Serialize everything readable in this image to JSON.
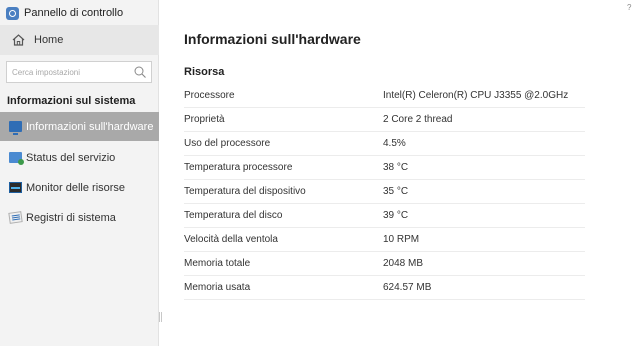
{
  "app": {
    "title": "Pannello di controllo"
  },
  "sidebar": {
    "home_label": "Home",
    "search_placeholder": "Cerca impostazioni",
    "section_title": "Informazioni sul sistema",
    "items": [
      {
        "label": "Informazioni sull'hardware",
        "icon": "hardware-icon",
        "active": true
      },
      {
        "label": "Status del servizio",
        "icon": "service-status-icon",
        "active": false
      },
      {
        "label": "Monitor delle risorse",
        "icon": "resource-monitor-icon",
        "active": false
      },
      {
        "label": "Registri di sistema",
        "icon": "system-logs-icon",
        "active": false
      }
    ]
  },
  "help_label": "?",
  "main": {
    "title": "Informazioni sull'hardware",
    "section": "Risorsa",
    "rows": [
      {
        "key": "Processore",
        "value": "Intel(R) Celeron(R) CPU J3355 @2.0GHz"
      },
      {
        "key": "Proprietà",
        "value": "2 Core 2 thread"
      },
      {
        "key": "Uso del processore",
        "value": "4.5%"
      },
      {
        "key": "Temperatura processore",
        "value": "38 °C"
      },
      {
        "key": "Temperatura del dispositivo",
        "value": "35 °C"
      },
      {
        "key": "Temperatura del disco",
        "value": "39 °C"
      },
      {
        "key": "Velocità della ventola",
        "value": "10 RPM"
      },
      {
        "key": "Memoria totale",
        "value": "2048 MB"
      },
      {
        "key": "Memoria usata",
        "value": "624.57 MB"
      }
    ]
  },
  "colors": {
    "active_item_bg": "#a9a9a9",
    "sidebar_bg": "#f3f3f3",
    "accent": "#2f6db5"
  }
}
